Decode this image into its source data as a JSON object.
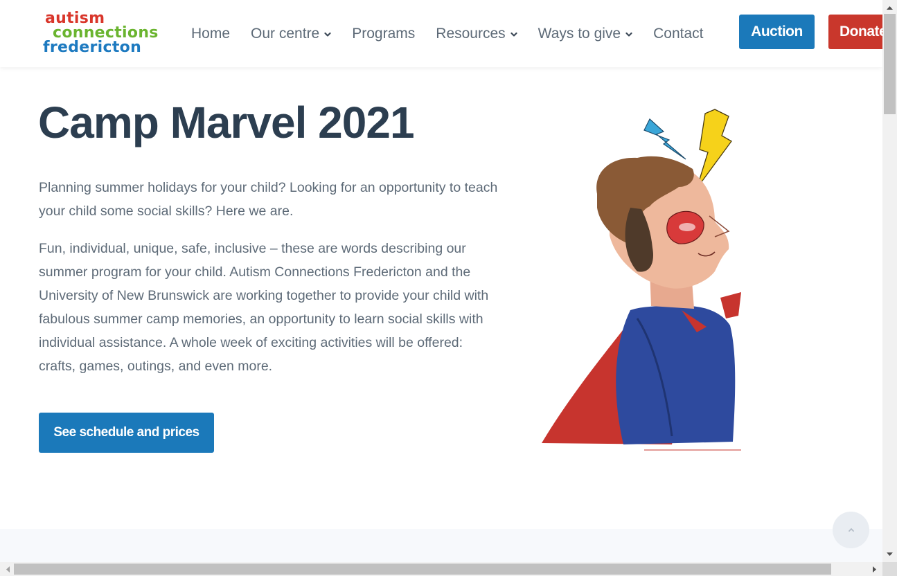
{
  "logo": {
    "line1": "autism",
    "line2": "connections",
    "line3": "fredericton"
  },
  "nav": {
    "items": [
      {
        "label": "Home",
        "dropdown": false
      },
      {
        "label": "Our centre",
        "dropdown": true
      },
      {
        "label": "Programs",
        "dropdown": false
      },
      {
        "label": "Resources",
        "dropdown": true
      },
      {
        "label": "Ways to give",
        "dropdown": true
      },
      {
        "label": "Contact",
        "dropdown": false
      }
    ],
    "auction_label": "Auction",
    "donate_label": "Donate"
  },
  "hero": {
    "title": "Camp Marvel 2021",
    "paragraph1": "Planning summer holidays for your child? Looking for an opportunity to teach your child some social skills? Here we are.",
    "paragraph2": "Fun, individual, unique, safe, inclusive – these are words describing our summer program for your child. Autism Connections Fredericton and the University of New Brunswick are working together to provide your child with fabulous summer camp memories, an opportunity to learn social skills with individual assistance. A whole week of exciting activities will be offered: crafts, games, outings, and even more.",
    "button_label": "See schedule and prices"
  },
  "colors": {
    "primary_blue": "#1b79ba",
    "donate_red": "#c9372c",
    "logo_red": "#d9362b",
    "logo_green": "#6ab42f",
    "logo_blue": "#1d7ac0",
    "heading": "#2c3e50",
    "body_text": "#5d6a77"
  },
  "icons": {
    "nav_dropdown": "chevron-down-icon",
    "scroll_top": "chevron-up-icon",
    "illustration": "superhero-illustration"
  }
}
